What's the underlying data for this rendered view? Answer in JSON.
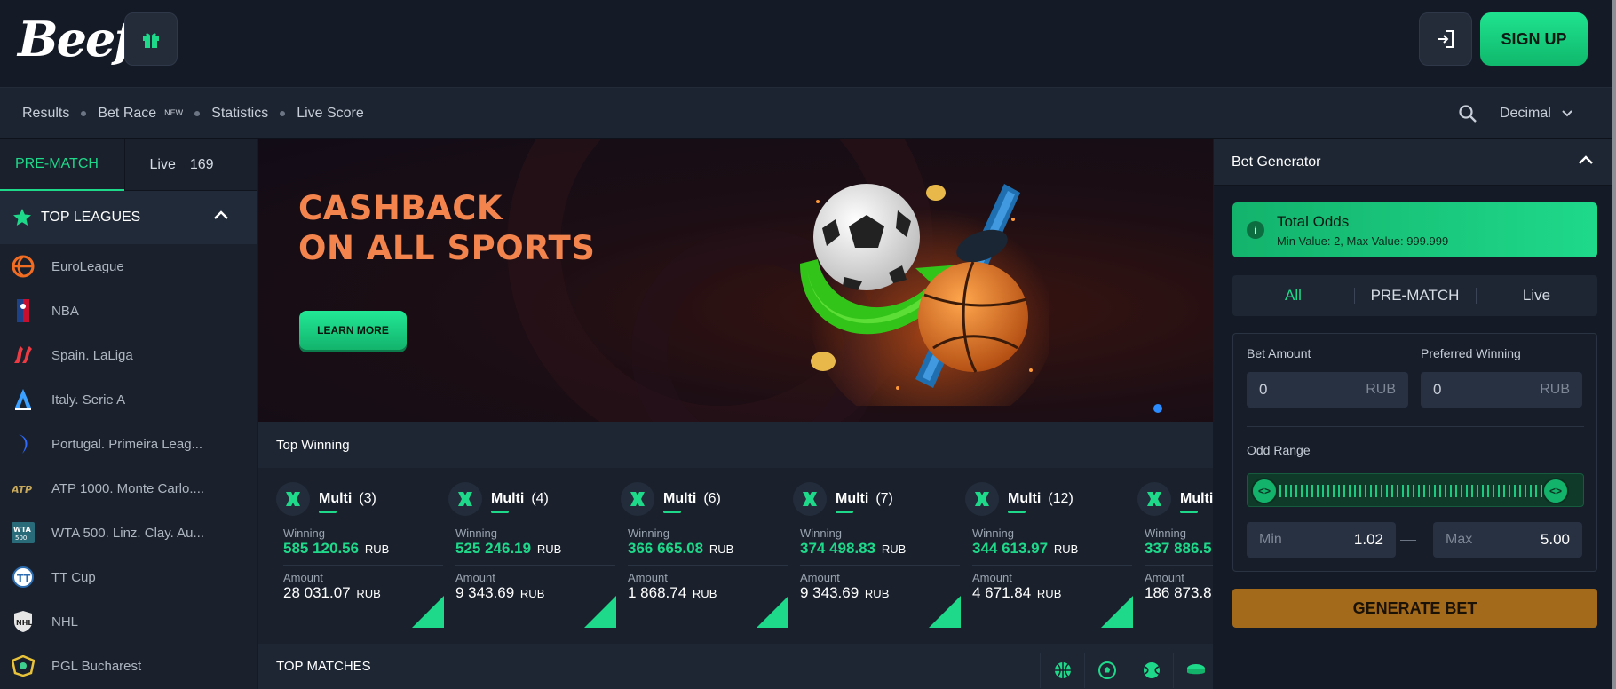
{
  "header": {
    "logo": "Beef",
    "signup_label": "SIGN UP"
  },
  "nav": {
    "items": [
      "Results",
      "Bet Race",
      "Statistics",
      "Live Score"
    ],
    "new_badge": "NEW",
    "odds_format": "Decimal"
  },
  "sidebar": {
    "tab_prematch": "PRE-MATCH",
    "tab_live": "Live",
    "live_count": "169",
    "top_leagues_title": "TOP LEAGUES",
    "leagues": [
      {
        "name": "EuroLeague",
        "icon": "euroleague-icon"
      },
      {
        "name": "NBA",
        "icon": "nba-icon"
      },
      {
        "name": "Spain. LaLiga",
        "icon": "laliga-icon"
      },
      {
        "name": "Italy. Serie A",
        "icon": "serie-a-icon"
      },
      {
        "name": "Portugal. Primeira Leag...",
        "icon": "primeira-liga-icon"
      },
      {
        "name": "ATP 1000. Monte Carlo....",
        "icon": "atp-icon"
      },
      {
        "name": "WTA 500. Linz. Clay. Au...",
        "icon": "wta-icon"
      },
      {
        "name": "TT Cup",
        "icon": "tt-cup-icon"
      },
      {
        "name": "NHL",
        "icon": "nhl-icon"
      },
      {
        "name": "PGL Bucharest",
        "icon": "pgl-icon"
      }
    ]
  },
  "banner": {
    "line1": "CASHBACK",
    "line2": "ON ALL SPORTS",
    "cta": "LEARN MORE"
  },
  "top_winning": {
    "title": "Top Winning",
    "winning_label": "Winning",
    "amount_label": "Amount",
    "currency": "RUB",
    "cards": [
      {
        "type": "Multi",
        "count": "(3)",
        "winning": "585 120.56",
        "amount": "28 031.07"
      },
      {
        "type": "Multi",
        "count": "(4)",
        "winning": "525 246.19",
        "amount": "9 343.69"
      },
      {
        "type": "Multi",
        "count": "(6)",
        "winning": "366 665.08",
        "amount": "1 868.74"
      },
      {
        "type": "Multi",
        "count": "(7)",
        "winning": "374 498.83",
        "amount": "9 343.69"
      },
      {
        "type": "Multi",
        "count": "(12)",
        "winning": "344 613.97",
        "amount": "4 671.84"
      },
      {
        "type": "Multi",
        "count": "",
        "winning": "337 886.5",
        "amount": "186 873.8"
      }
    ]
  },
  "top_matches": {
    "title": "TOP MATCHES",
    "sport_icons": [
      "basketball-icon",
      "soccer-icon",
      "tennis-icon",
      "hockey-icon"
    ]
  },
  "bet_generator": {
    "title": "Bet Generator",
    "total_odds_title": "Total Odds",
    "total_odds_hint": "Min Value: 2, Max Value: 999.999",
    "segments": [
      "All",
      "PRE-MATCH",
      "Live"
    ],
    "bet_amount_label": "Bet Amount",
    "bet_amount_value": "0",
    "preferred_winning_label": "Preferred Winning",
    "preferred_winning_value": "0",
    "currency": "RUB",
    "odd_range_label": "Odd Range",
    "min_label": "Min",
    "min_value": "1.02",
    "max_label": "Max",
    "max_value": "5.00",
    "generate_label": "GENERATE BET"
  },
  "colors": {
    "accent": "#1fd98a",
    "banner_text": "#f3844e",
    "generate_button": "#a36a1c",
    "background": "#151b26"
  }
}
